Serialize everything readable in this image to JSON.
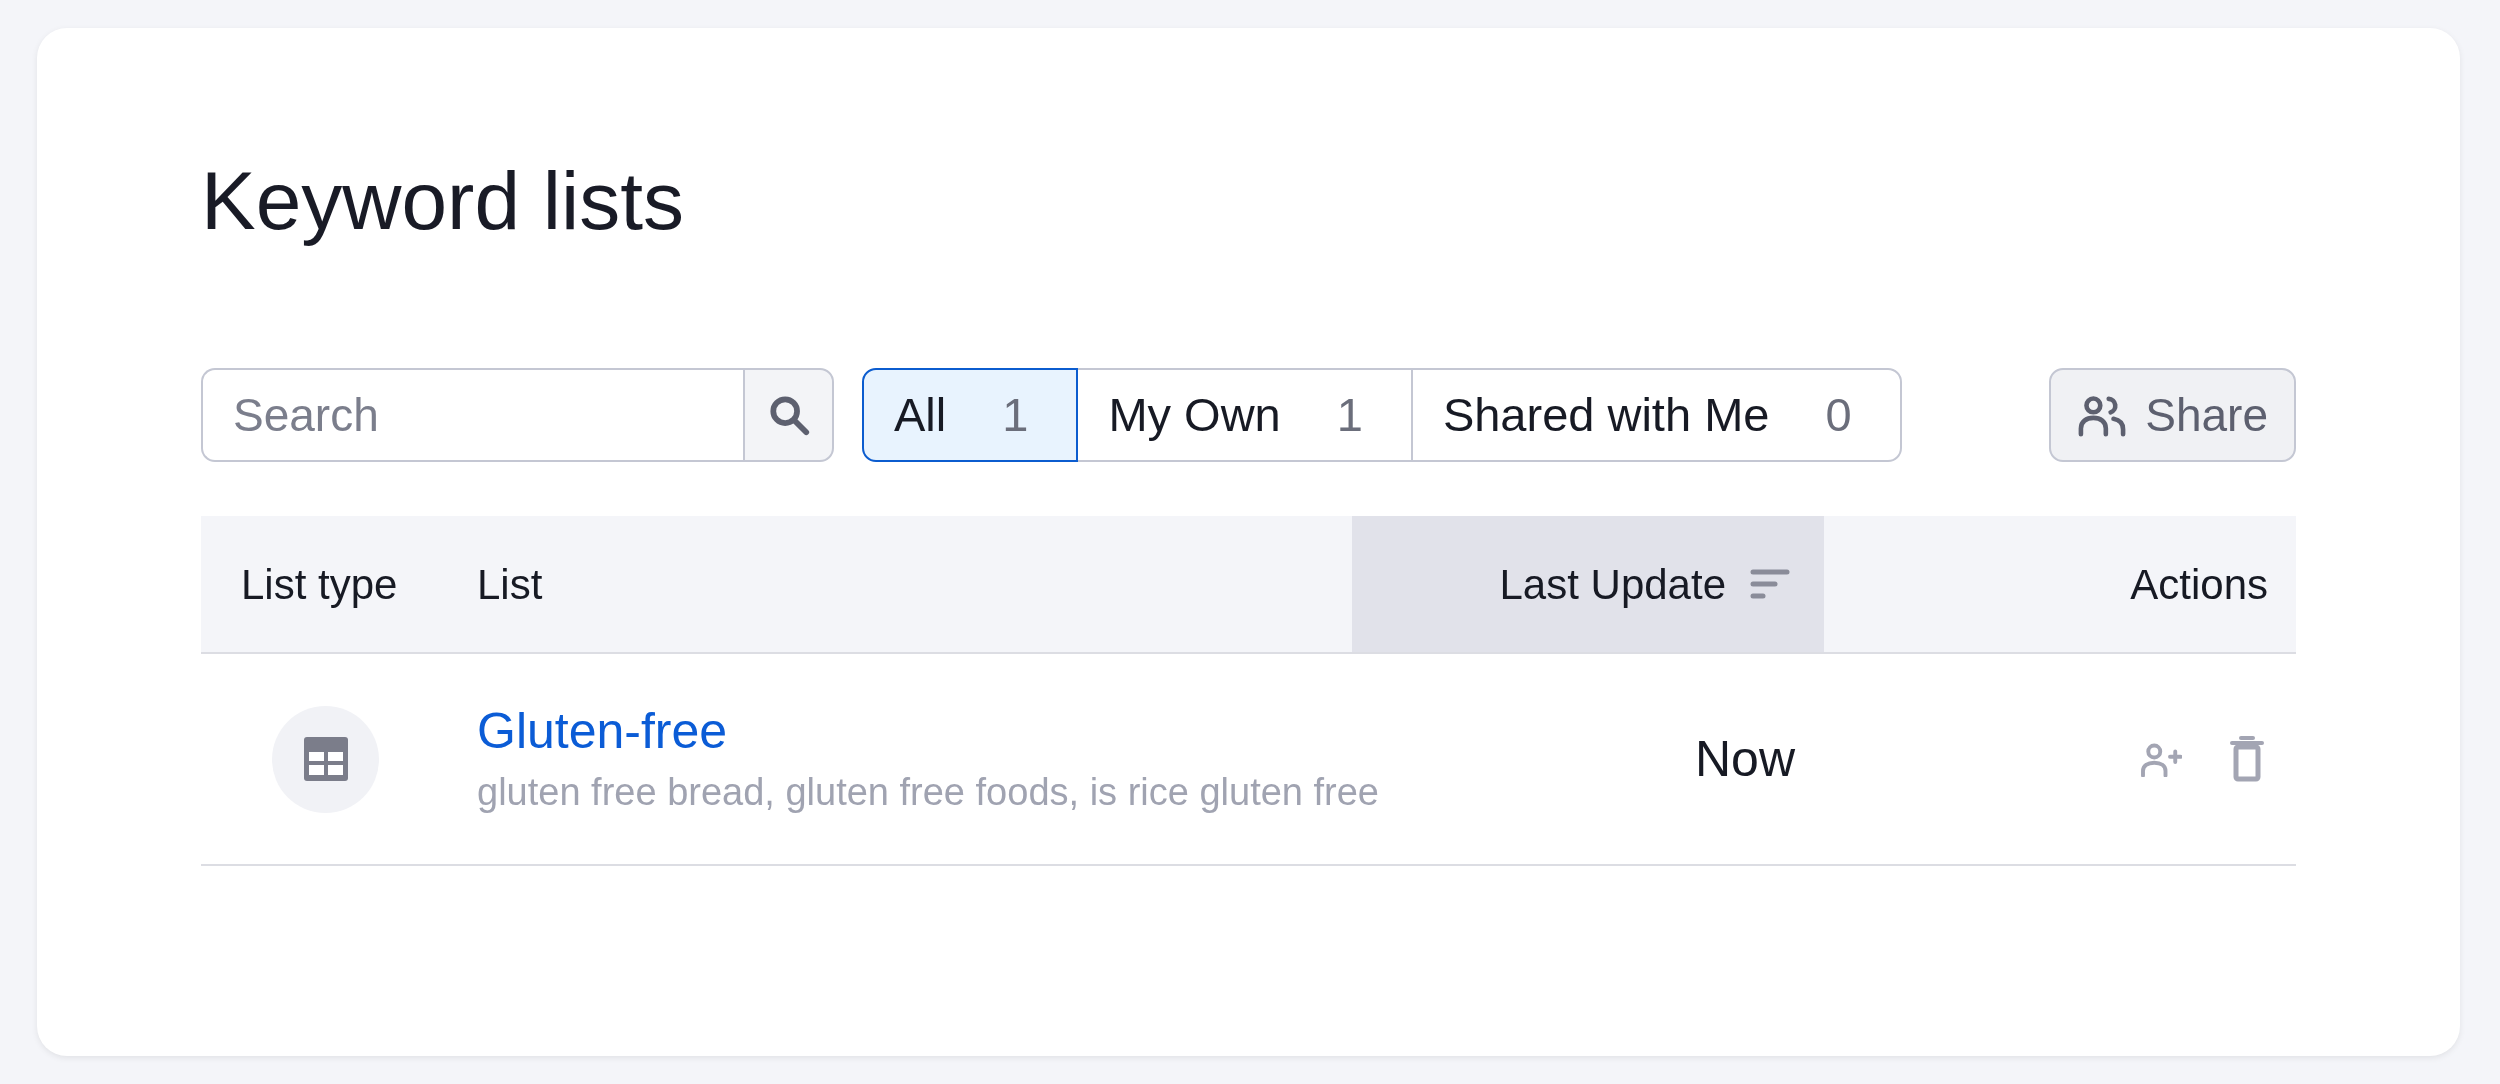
{
  "page": {
    "title": "Keyword lists"
  },
  "toolbar": {
    "search": {
      "placeholder": "Search"
    },
    "filters": [
      {
        "label": "All",
        "count": "1",
        "selected": true
      },
      {
        "label": "My Own",
        "count": "1",
        "selected": false
      },
      {
        "label": "Shared with Me",
        "count": "0",
        "selected": false
      }
    ],
    "share_button": {
      "label": "Share"
    }
  },
  "table": {
    "columns": [
      {
        "label": "List type",
        "sorted": false
      },
      {
        "label": "List",
        "sorted": false
      },
      {
        "label": "Last Update",
        "sorted": true
      },
      {
        "label": "Actions",
        "sorted": false
      }
    ],
    "rows": [
      {
        "name": "Gluten-free",
        "keywords": "gluten free bread, gluten free foods, is rice gluten free",
        "last_update": "Now"
      }
    ]
  }
}
